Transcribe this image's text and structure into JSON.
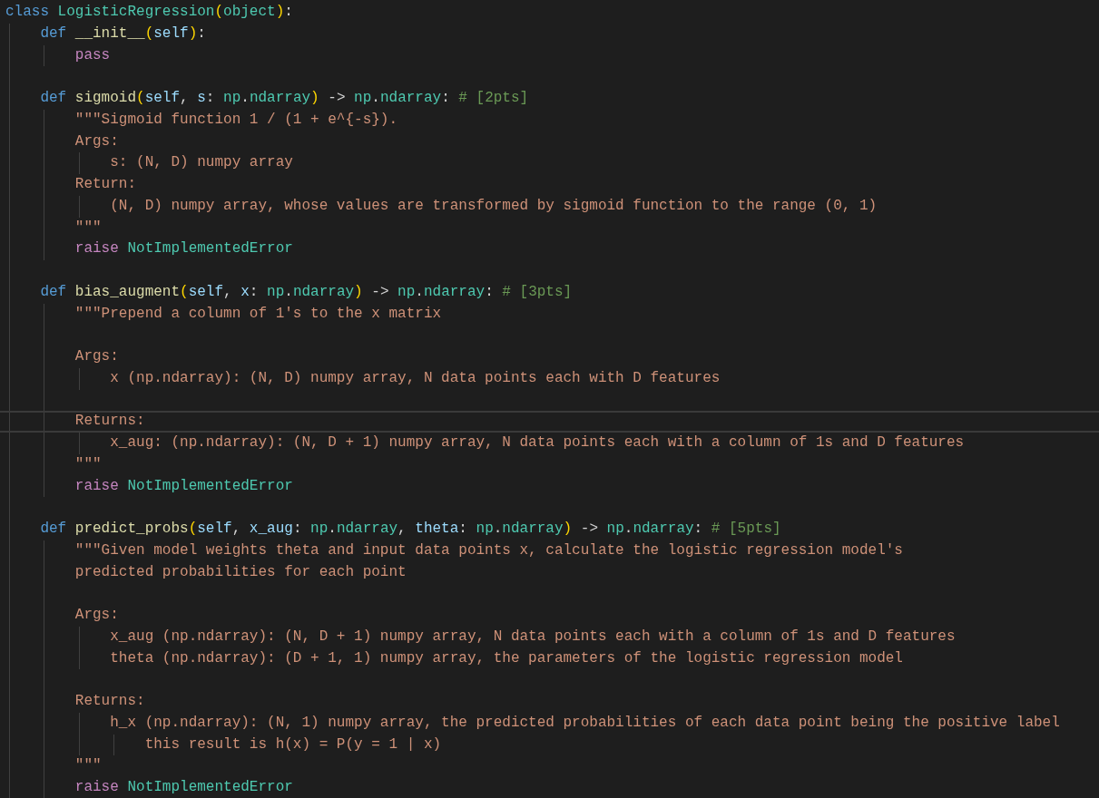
{
  "editor": {
    "lines": [
      {
        "current": false,
        "tokens": [
          {
            "kind": "keyword",
            "text": "class "
          },
          {
            "kind": "class",
            "text": "LogisticRegression"
          },
          {
            "kind": "bracket",
            "text": "("
          },
          {
            "kind": "class",
            "text": "object"
          },
          {
            "kind": "bracket",
            "text": ")"
          },
          {
            "kind": "plain",
            "text": ":"
          }
        ]
      },
      {
        "current": false,
        "tokens": [
          {
            "kind": "keyword",
            "text": "    def "
          },
          {
            "kind": "function",
            "text": "__init__"
          },
          {
            "kind": "bracket",
            "text": "("
          },
          {
            "kind": "param",
            "text": "self"
          },
          {
            "kind": "bracket",
            "text": ")"
          },
          {
            "kind": "plain",
            "text": ":"
          }
        ]
      },
      {
        "current": false,
        "tokens": [
          {
            "kind": "control",
            "text": "        pass"
          }
        ]
      },
      {
        "current": false
      },
      {
        "current": false,
        "tokens": [
          {
            "kind": "keyword",
            "text": "    def "
          },
          {
            "kind": "function",
            "text": "sigmoid"
          },
          {
            "kind": "bracket",
            "text": "("
          },
          {
            "kind": "param",
            "text": "self"
          },
          {
            "kind": "plain",
            "text": ", "
          },
          {
            "kind": "param",
            "text": "s"
          },
          {
            "kind": "plain",
            "text": ": "
          },
          {
            "kind": "class",
            "text": "np"
          },
          {
            "kind": "plain",
            "text": "."
          },
          {
            "kind": "class",
            "text": "ndarray"
          },
          {
            "kind": "bracket",
            "text": ")"
          },
          {
            "kind": "plain",
            "text": " -> "
          },
          {
            "kind": "class",
            "text": "np"
          },
          {
            "kind": "plain",
            "text": "."
          },
          {
            "kind": "class",
            "text": "ndarray"
          },
          {
            "kind": "plain",
            "text": ": "
          },
          {
            "kind": "comment",
            "text": "# [2pts]"
          }
        ]
      },
      {
        "current": false,
        "tokens": [
          {
            "kind": "string",
            "text": "        \"\"\"Sigmoid function 1 / (1 + e^{-s})."
          }
        ]
      },
      {
        "current": false,
        "tokens": [
          {
            "kind": "string",
            "text": "        Args:"
          }
        ]
      },
      {
        "current": false,
        "tokens": [
          {
            "kind": "string",
            "text": "            s: (N, D) numpy array"
          }
        ]
      },
      {
        "current": false,
        "tokens": [
          {
            "kind": "string",
            "text": "        Return:"
          }
        ]
      },
      {
        "current": false,
        "tokens": [
          {
            "kind": "string",
            "text": "            (N, D) numpy array, whose values are transformed by sigmoid function to the range (0, 1)"
          }
        ]
      },
      {
        "current": false,
        "tokens": [
          {
            "kind": "string",
            "text": "        \"\"\""
          }
        ]
      },
      {
        "current": false,
        "tokens": [
          {
            "kind": "control",
            "text": "        raise "
          },
          {
            "kind": "class",
            "text": "NotImplementedError"
          }
        ]
      },
      {
        "current": false
      },
      {
        "current": false,
        "tokens": [
          {
            "kind": "keyword",
            "text": "    def "
          },
          {
            "kind": "function",
            "text": "bias_augment"
          },
          {
            "kind": "bracket",
            "text": "("
          },
          {
            "kind": "param",
            "text": "self"
          },
          {
            "kind": "plain",
            "text": ", "
          },
          {
            "kind": "param",
            "text": "x"
          },
          {
            "kind": "plain",
            "text": ": "
          },
          {
            "kind": "class",
            "text": "np"
          },
          {
            "kind": "plain",
            "text": "."
          },
          {
            "kind": "class",
            "text": "ndarray"
          },
          {
            "kind": "bracket",
            "text": ")"
          },
          {
            "kind": "plain",
            "text": " -> "
          },
          {
            "kind": "class",
            "text": "np"
          },
          {
            "kind": "plain",
            "text": "."
          },
          {
            "kind": "class",
            "text": "ndarray"
          },
          {
            "kind": "plain",
            "text": ": "
          },
          {
            "kind": "comment",
            "text": "# [3pts]"
          }
        ]
      },
      {
        "current": false,
        "tokens": [
          {
            "kind": "string",
            "text": "        \"\"\"Prepend a column of 1's to the x matrix"
          }
        ]
      },
      {
        "current": false
      },
      {
        "current": false,
        "tokens": [
          {
            "kind": "string",
            "text": "        Args:"
          }
        ]
      },
      {
        "current": false,
        "tokens": [
          {
            "kind": "string",
            "text": "            x (np.ndarray): (N, D) numpy array, N data points each with D features"
          }
        ]
      },
      {
        "current": false
      },
      {
        "current": true,
        "tokens": [
          {
            "kind": "string",
            "text": "        Returns:"
          }
        ]
      },
      {
        "current": false,
        "tokens": [
          {
            "kind": "string",
            "text": "            x_aug: (np.ndarray): (N, D + 1) numpy array, N data points each with a column of 1s and D features"
          }
        ]
      },
      {
        "current": false,
        "tokens": [
          {
            "kind": "string",
            "text": "        \"\"\""
          }
        ]
      },
      {
        "current": false,
        "tokens": [
          {
            "kind": "control",
            "text": "        raise "
          },
          {
            "kind": "class",
            "text": "NotImplementedError"
          }
        ]
      },
      {
        "current": false
      },
      {
        "current": false,
        "tokens": [
          {
            "kind": "keyword",
            "text": "    def "
          },
          {
            "kind": "function",
            "text": "predict_probs"
          },
          {
            "kind": "bracket",
            "text": "("
          },
          {
            "kind": "param",
            "text": "self"
          },
          {
            "kind": "plain",
            "text": ", "
          },
          {
            "kind": "param",
            "text": "x_aug"
          },
          {
            "kind": "plain",
            "text": ": "
          },
          {
            "kind": "class",
            "text": "np"
          },
          {
            "kind": "plain",
            "text": "."
          },
          {
            "kind": "class",
            "text": "ndarray"
          },
          {
            "kind": "plain",
            "text": ", "
          },
          {
            "kind": "param",
            "text": "theta"
          },
          {
            "kind": "plain",
            "text": ": "
          },
          {
            "kind": "class",
            "text": "np"
          },
          {
            "kind": "plain",
            "text": "."
          },
          {
            "kind": "class",
            "text": "ndarray"
          },
          {
            "kind": "bracket",
            "text": ")"
          },
          {
            "kind": "plain",
            "text": " -> "
          },
          {
            "kind": "class",
            "text": "np"
          },
          {
            "kind": "plain",
            "text": "."
          },
          {
            "kind": "class",
            "text": "ndarray"
          },
          {
            "kind": "plain",
            "text": ": "
          },
          {
            "kind": "comment",
            "text": "# [5pts]"
          }
        ]
      },
      {
        "current": false,
        "tokens": [
          {
            "kind": "string",
            "text": "        \"\"\"Given model weights theta and input data points x, calculate the logistic regression model's"
          }
        ]
      },
      {
        "current": false,
        "tokens": [
          {
            "kind": "string",
            "text": "        predicted probabilities for each point"
          }
        ]
      },
      {
        "current": false
      },
      {
        "current": false,
        "tokens": [
          {
            "kind": "string",
            "text": "        Args:"
          }
        ]
      },
      {
        "current": false,
        "tokens": [
          {
            "kind": "string",
            "text": "            x_aug (np.ndarray): (N, D + 1) numpy array, N data points each with a column of 1s and D features"
          }
        ]
      },
      {
        "current": false,
        "tokens": [
          {
            "kind": "string",
            "text": "            theta (np.ndarray): (D + 1, 1) numpy array, the parameters of the logistic regression model"
          }
        ]
      },
      {
        "current": false
      },
      {
        "current": false,
        "tokens": [
          {
            "kind": "string",
            "text": "        Returns:"
          }
        ]
      },
      {
        "current": false,
        "tokens": [
          {
            "kind": "string",
            "text": "            h_x (np.ndarray): (N, 1) numpy array, the predicted probabilities of each data point being the positive label"
          }
        ]
      },
      {
        "current": false,
        "tokens": [
          {
            "kind": "string",
            "text": "                this result is h(x) = P(y = 1 | x)"
          }
        ]
      },
      {
        "current": false,
        "tokens": [
          {
            "kind": "string",
            "text": "        \"\"\""
          }
        ]
      },
      {
        "current": false,
        "tokens": [
          {
            "kind": "control",
            "text": "        raise "
          },
          {
            "kind": "class",
            "text": "NotImplementedError"
          }
        ]
      }
    ]
  }
}
